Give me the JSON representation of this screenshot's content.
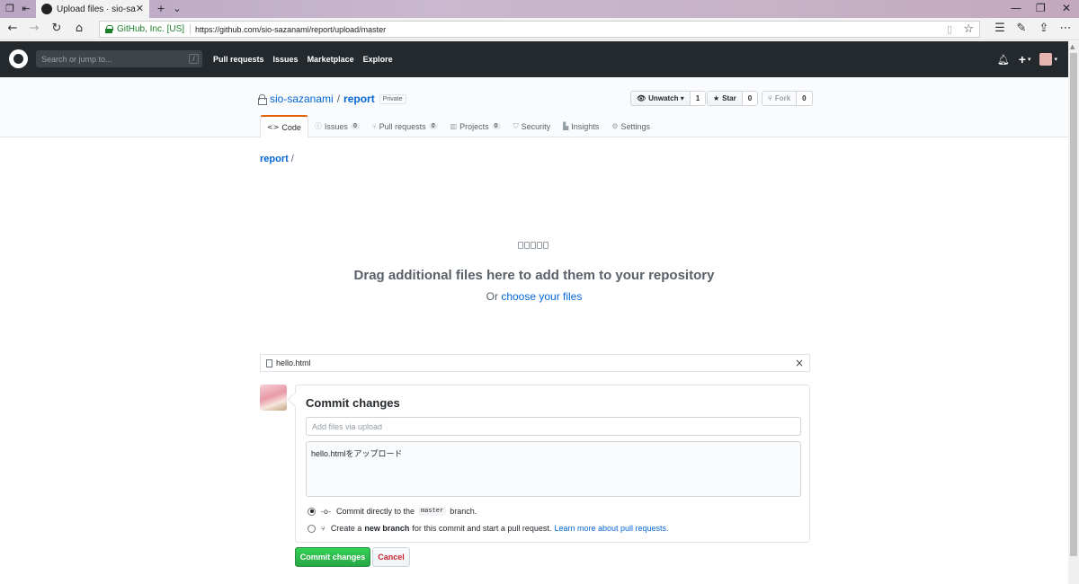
{
  "browser": {
    "tab_title": "Upload files · sio-sazana",
    "cert_name": "GitHub, Inc. [US]",
    "url": "https://github.com/sio-sazanami/report/upload/master"
  },
  "gh_header": {
    "search_placeholder": "Search or jump to...",
    "search_shortcut": "/",
    "nav": [
      "Pull requests",
      "Issues",
      "Marketplace",
      "Explore"
    ]
  },
  "repo": {
    "owner": "sio-sazanami",
    "separator": "/",
    "name": "report",
    "visibility": "Private",
    "watch_label": "Unwatch",
    "watch_count": "1",
    "star_label": "Star",
    "star_count": "0",
    "fork_label": "Fork",
    "fork_count": "0"
  },
  "reponav": [
    {
      "label": "Code",
      "icon": "code-icon",
      "count": ""
    },
    {
      "label": "Issues",
      "icon": "issue-icon",
      "count": "0"
    },
    {
      "label": "Pull requests",
      "icon": "pull-request-icon",
      "count": "0"
    },
    {
      "label": "Projects",
      "icon": "project-icon",
      "count": "0"
    },
    {
      "label": "Security",
      "icon": "shield-icon",
      "count": ""
    },
    {
      "label": "Insights",
      "icon": "graph-icon",
      "count": ""
    },
    {
      "label": "Settings",
      "icon": "gear-icon",
      "count": ""
    }
  ],
  "breadcrumb": {
    "root": "report",
    "slash": "/"
  },
  "dropzone": {
    "title": "Drag additional files here to add them to your repository",
    "prefix": "Or",
    "link": "choose your files"
  },
  "uploaded_file": {
    "name": "hello.html",
    "remove": "×"
  },
  "commit": {
    "title": "Commit changes",
    "summary_placeholder": "Add files via upload",
    "description": "hello.htmlをアップロード",
    "option1_prefix": "Commit directly to the",
    "option1_branch": "master",
    "option1_suffix": "branch.",
    "option2_prefix": "Create a",
    "option2_bold": "new branch",
    "option2_suffix": "for this commit and start a pull request.",
    "option2_link": "Learn more about pull requests.",
    "submit": "Commit changes",
    "cancel": "Cancel"
  },
  "colors": {
    "primary_link": "#0366d6",
    "header_bg": "#24292e",
    "commit_green": "#28a745",
    "cancel_red": "#cb2431",
    "tab_accent": "#e36209"
  }
}
